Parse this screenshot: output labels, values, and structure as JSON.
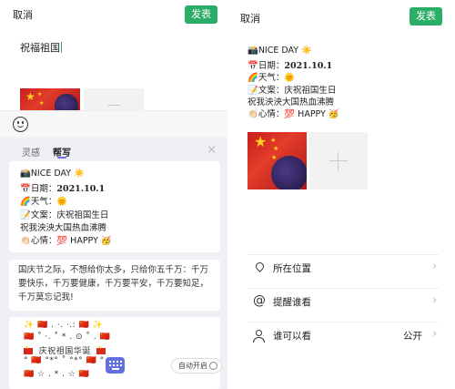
{
  "left": {
    "header": {
      "cancel": "取消",
      "publish": "发表"
    },
    "draft_text": "祝福祖国",
    "tabs": [
      "灵感",
      "帮写"
    ],
    "close": "×",
    "card1": {
      "line1": "📸NICE DAY ☀️",
      "line2_prefix": "📅日期：",
      "line2_date": "2021.10.1",
      "line3": "🌈天气：🌞",
      "line4": "📝文案：庆祝祖国生日",
      "line5": "祝我泱泱大国热血沸腾",
      "line6": "👏🏻心情：💯 HAPPY 🥳"
    },
    "card2_text": "国庆节之际，不想给你太多，只给你五千万：千万要快乐，千万要健康，千万要平安，千万要知足，千万莫忘记我!",
    "card3": {
      "row1": "✨ 🇨🇳 . ·.  ·.: 🇨🇳 ✨",
      "row2": "🇨🇳 ˚ ·. ˚ * . ⊙ ˚ . 🇨🇳",
      "row3_text": "庆祝祖国华诞",
      "row4": "° 🇨🇳 °*° ˚ °*° 🇨🇳 °",
      "row5": "🇨🇳 ☆ . * . ☆ 🇨🇳"
    },
    "auto_label": "自动开启"
  },
  "right": {
    "header": {
      "cancel": "取消",
      "publish": "发表"
    },
    "post": {
      "line1": "📸NICE DAY ☀️",
      "line2_prefix": "📅日期：",
      "line2_date": "2021.10.1",
      "line3": "🌈天气：🌞",
      "line4": "📝文案：庆祝祖国生日",
      "line5": "祝我泱泱大国热血沸腾",
      "line6": "👏🏻心情：💯 HAPPY 🥳"
    },
    "options": [
      {
        "label": "所在位置",
        "value": ""
      },
      {
        "label": "提醒谁看",
        "value": ""
      },
      {
        "label": "谁可以看",
        "value": "公开"
      }
    ]
  },
  "colors": {
    "accent_green": "#2aae67",
    "tab_underline": "#6b6ee8",
    "keyboard_button": "#6470e0"
  }
}
